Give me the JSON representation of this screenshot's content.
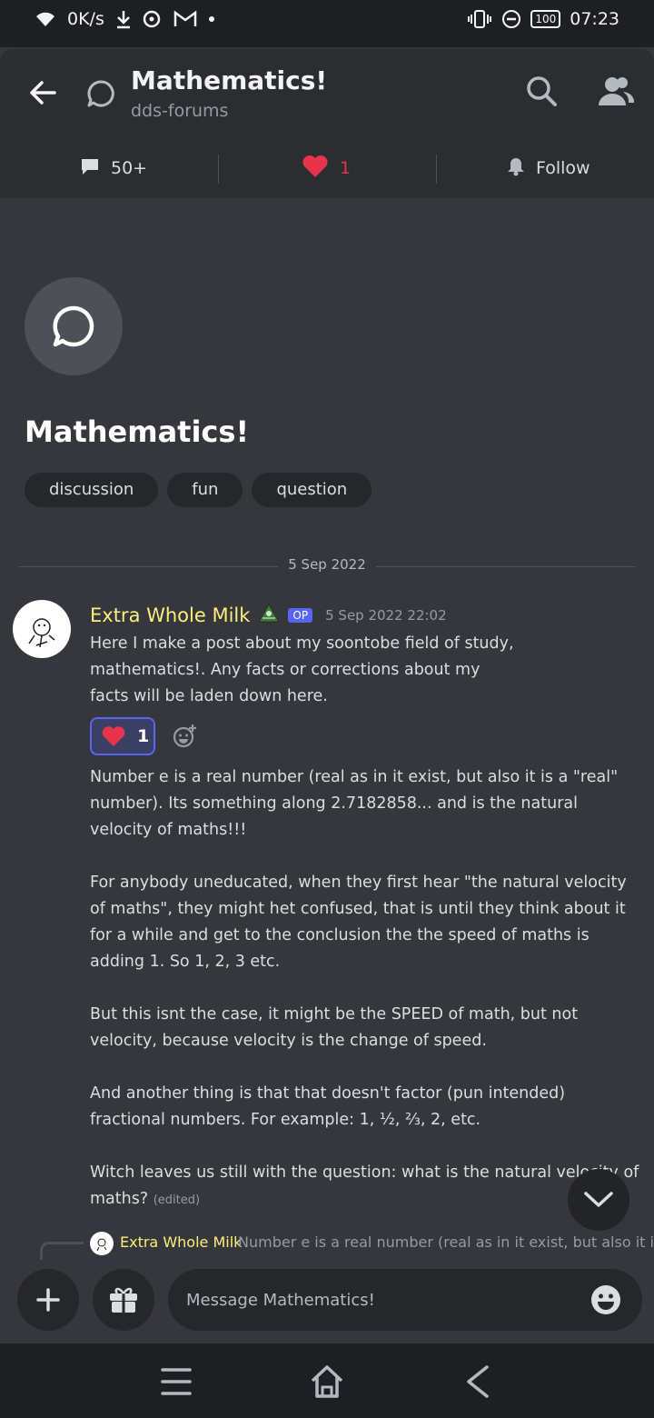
{
  "status_bar": {
    "net_speed": "0K/s",
    "battery": "100",
    "time": "07:23"
  },
  "header": {
    "title": "Mathematics!",
    "subtitle": "dds-forums",
    "messages_count": "50+",
    "reactions_count": "1",
    "follow_label": "Follow"
  },
  "post": {
    "title": "Mathematics!",
    "tags": [
      "discussion",
      "fun",
      "question"
    ]
  },
  "date_divider": "5 Sep 2022",
  "message": {
    "author": "Extra Whole Milk",
    "op_badge": "OP",
    "timestamp": "5 Sep 2022 22:02",
    "intro": "Here I make a post about my soontobe field of study, mathematics!. Any facts or corrections about my facts will be laden down here.",
    "reaction_count": "1",
    "paragraphs": [
      "Number e is a real number (real as in it exist, but also it is a \"real\" number). Its something along 2.7182858... and is the natural velocity of maths!!!",
      "For anybody uneducated, when they first hear \"the natural velocity of maths\", they might het confused, that is until they think about it for a while and get to the conclusion the the speed of maths is adding 1. So 1, 2, 3 etc.",
      "But this isnt the case, it might be the SPEED of math, but not velocity, because velocity is the change of speed.",
      "And another thing is that that doesn't factor (pun intended) fractional numbers. For example: 1, ½, ⅔, 2, etc."
    ],
    "last_paragraph": "Witch leaves us still with the question: what is the natural velocity of maths?",
    "edited_label": "(edited)"
  },
  "reply_preview": {
    "author": "Extra Whole Milk",
    "text": "Number e is a real number (real as in it exist, but also it is"
  },
  "composer": {
    "placeholder": "Message Mathematics!"
  },
  "colors": {
    "accent": "#5865f2",
    "author_name": "#f8f07a",
    "heart": "#e8344a"
  }
}
